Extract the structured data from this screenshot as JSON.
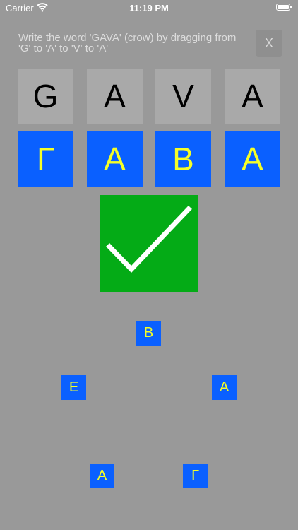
{
  "status_bar": {
    "carrier": "Carrier",
    "time": "11:19 PM"
  },
  "instruction": "Write the word 'GAVA' (crow) by dragging from 'G' to 'A' to 'V' to 'A'",
  "close_label": "X",
  "target_word": [
    "G",
    "A",
    "V",
    "A"
  ],
  "answer_letters": [
    "Г",
    "А",
    "В",
    "А"
  ],
  "options": {
    "top": "В",
    "left": "Е",
    "right": "А",
    "bottom_left": "А",
    "bottom_right": "Г"
  },
  "colors": {
    "background": "#999999",
    "target_tile": "#a9a9a9",
    "answer_tile": "#0a60ff",
    "answer_text": "#f5ff27",
    "success": "#04ab16"
  },
  "icons": {
    "success": "checkmark-icon",
    "signal": "wifi-icon",
    "power": "battery-icon"
  }
}
